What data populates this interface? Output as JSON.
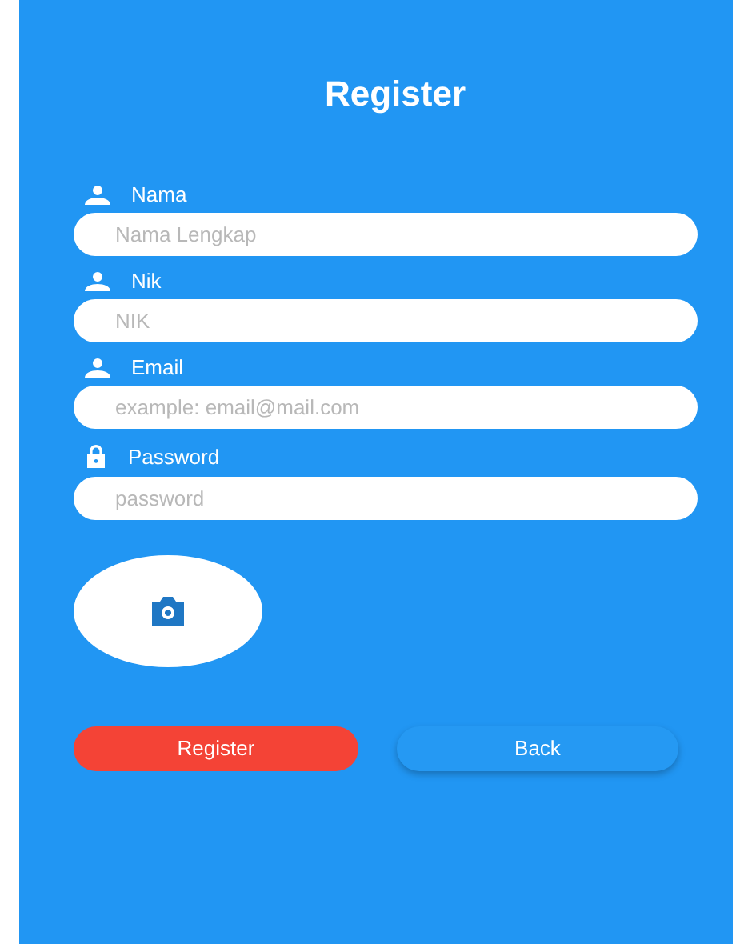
{
  "title": "Register",
  "fields": [
    {
      "label": "Nama",
      "kind": "text",
      "placeholder": "Nama Lengkap"
    },
    {
      "label": "Nik",
      "kind": "text",
      "placeholder": "NIK"
    },
    {
      "label": "Email",
      "kind": "text",
      "placeholder": "example: email@mail.com"
    },
    {
      "label": "Password",
      "kind": "password",
      "placeholder": "password"
    }
  ],
  "buttons": [
    {
      "label": "Register",
      "kind": "primary"
    },
    {
      "label": "Back",
      "kind": "secondary"
    }
  ]
}
